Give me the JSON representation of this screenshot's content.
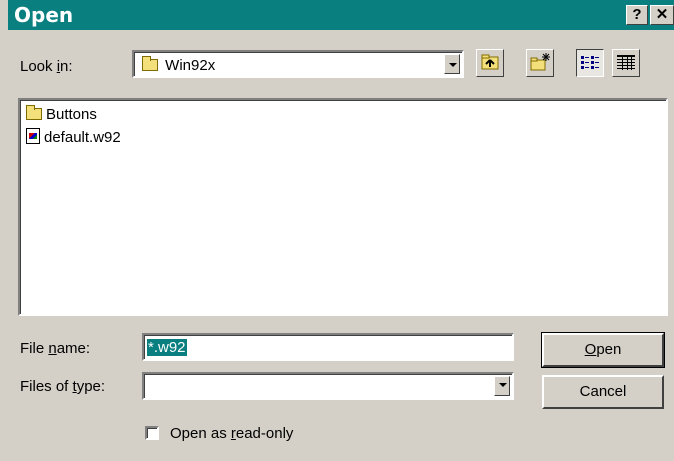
{
  "window": {
    "title": "Open",
    "help_label": "?",
    "close_label": "✕"
  },
  "look_in": {
    "label_pre": "Look ",
    "label_key": "i",
    "label_post": "n:",
    "value": "Win92x"
  },
  "toolbar": {
    "icons": [
      "up-one-level-icon",
      "create-new-folder-icon",
      "list-view-icon",
      "details-view-icon"
    ]
  },
  "files": [
    {
      "name": "Buttons",
      "icon": "folder-icon"
    },
    {
      "name": "default.w92",
      "icon": "document-icon"
    }
  ],
  "file_name": {
    "label_pre": "File ",
    "label_key": "n",
    "label_post": "ame:",
    "value": "*.w92"
  },
  "file_type": {
    "label_pre": "Files of ",
    "label_key": "t",
    "label_post": "ype:",
    "value": ""
  },
  "buttons": {
    "open_key": "O",
    "open_rest": "pen",
    "cancel": "Cancel"
  },
  "read_only": {
    "label_pre": "Open as ",
    "label_key": "r",
    "label_post": "ead-only",
    "checked": false
  },
  "colors": {
    "titlebar": "#0a7f7f",
    "dialog_face": "#d4d0c8",
    "selection": "#0a7f7f"
  }
}
